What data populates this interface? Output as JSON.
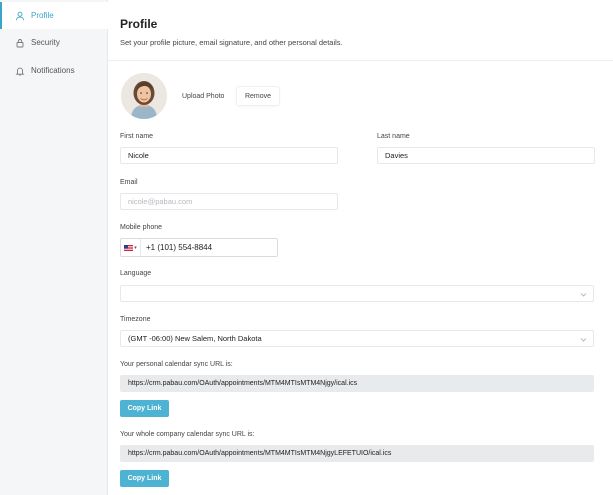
{
  "sidebar": {
    "items": [
      {
        "label": "Profile",
        "icon": "user-icon",
        "active": true
      },
      {
        "label": "Security",
        "icon": "lock-icon",
        "active": false
      },
      {
        "label": "Notifications",
        "icon": "bell-icon",
        "active": false
      }
    ]
  },
  "header": {
    "title": "Profile",
    "subtitle": "Set your profile picture, email signature, and other personal details."
  },
  "photo": {
    "upload_label": "Upload Photo",
    "remove_label": "Remove"
  },
  "form": {
    "first_name": {
      "label": "First name",
      "value": "Nicole"
    },
    "last_name": {
      "label": "Last name",
      "value": "Davies"
    },
    "email": {
      "label": "Email",
      "placeholder": "nicole@pabau.com"
    },
    "mobile": {
      "label": "Mobile phone",
      "value": "+1 (101) 554-8844",
      "country": "us-flag-icon"
    },
    "language": {
      "label": "Language",
      "value": ""
    },
    "timezone": {
      "label": "Timezone",
      "value": "(GMT -06:00) New Salem, North Dakota"
    },
    "personal_calendar": {
      "label": "Your personal calendar sync URL is:",
      "value": "https://crm.pabau.com/OAuth/appointments/MTM4MTIsMTM4Njgy/ical.ics",
      "button": "Copy Link"
    },
    "company_calendar": {
      "label": "Your whole company calendar sync URL is:",
      "value": "https://crm.pabau.com/OAuth/appointments/MTM4MTIsMTM4NjgyLEFETUIO/ical.ics",
      "button": "Copy Link"
    }
  },
  "colors": {
    "accent": "#3aa5c8",
    "button": "#4eb3d3",
    "readonly_bg": "#e9eaec"
  }
}
